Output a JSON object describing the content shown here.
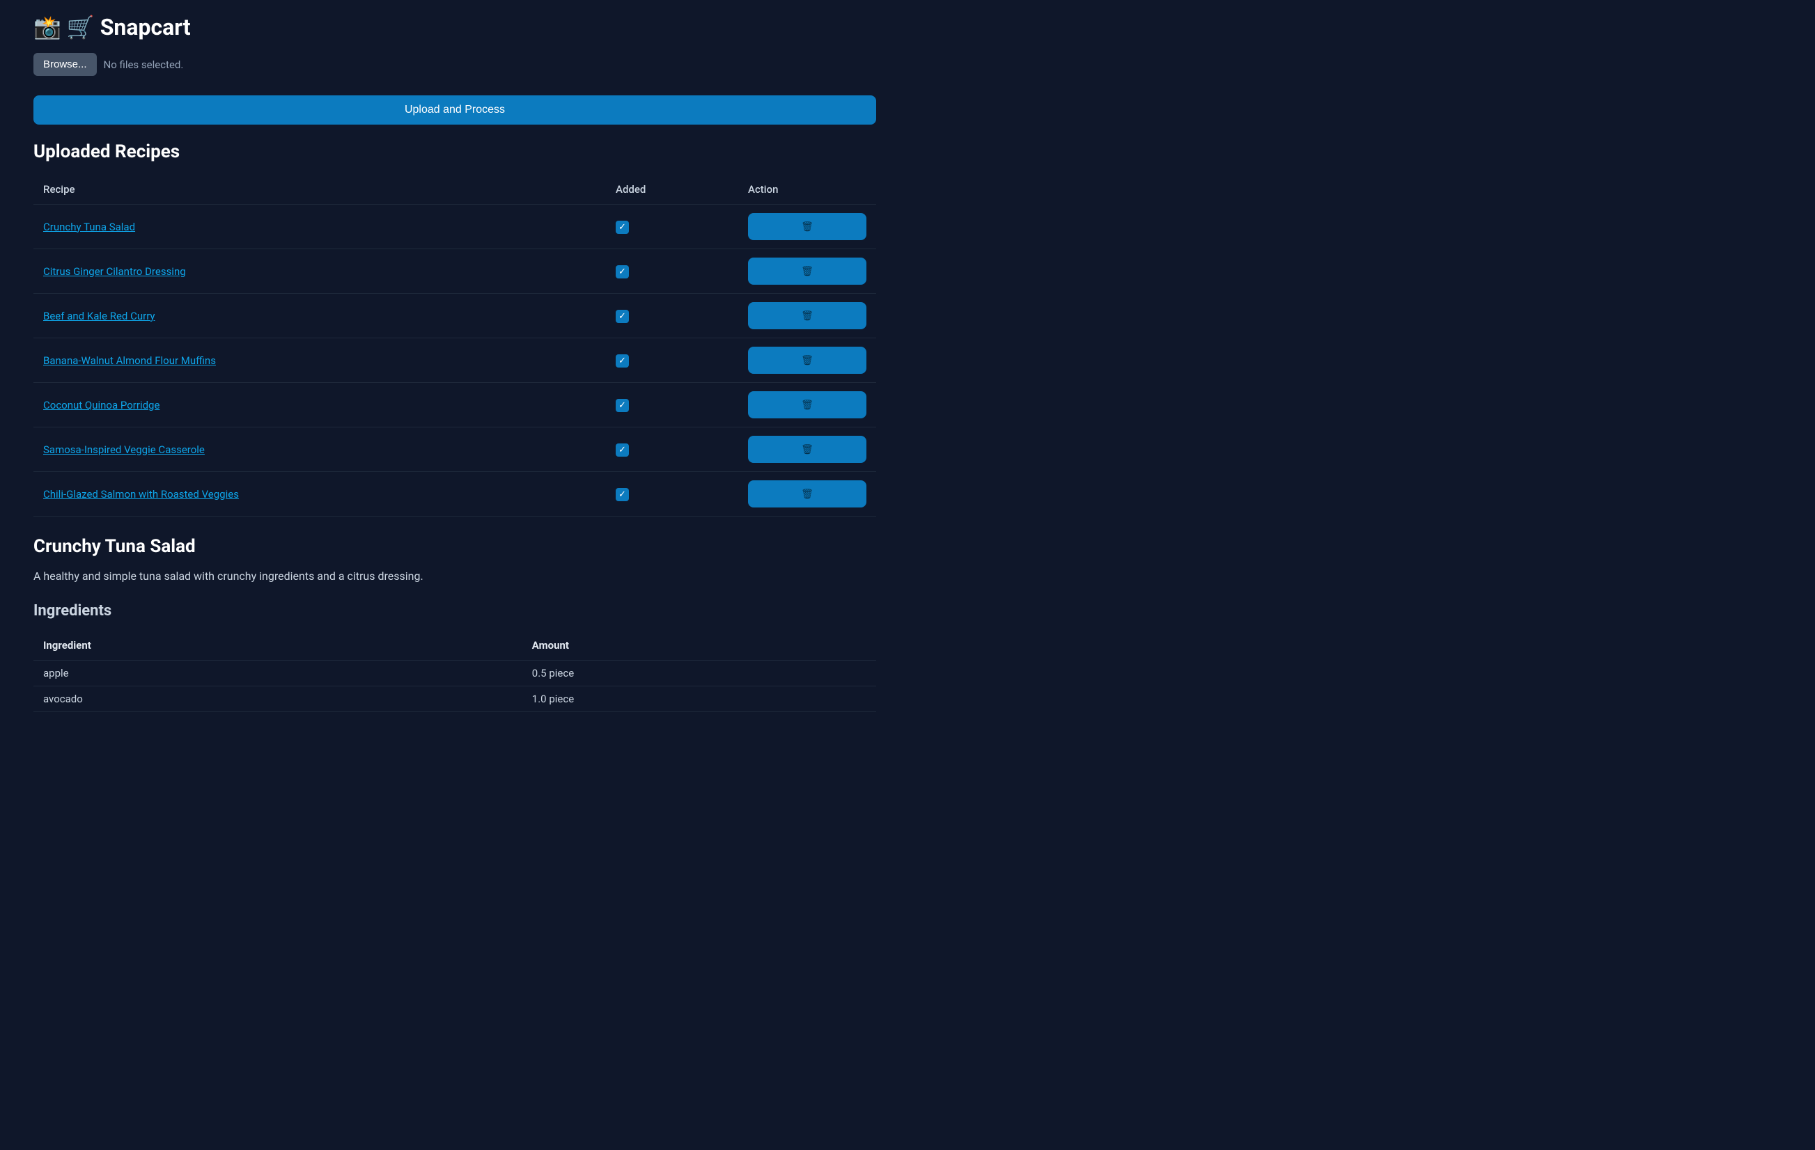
{
  "header": {
    "emoji_camera": "📸",
    "emoji_cart": "🛒",
    "title": "Snapcart"
  },
  "file_upload": {
    "browse_label": "Browse...",
    "status_text": "No files selected."
  },
  "buttons": {
    "upload_process": "Upload and Process"
  },
  "recipes_section": {
    "title": "Uploaded Recipes",
    "columns": {
      "recipe": "Recipe",
      "added": "Added",
      "action": "Action"
    },
    "rows": [
      {
        "name": "Crunchy Tuna Salad",
        "added": true,
        "active": true
      },
      {
        "name": "Citrus Ginger Cilantro Dressing",
        "added": true,
        "active": false
      },
      {
        "name": "Beef and Kale Red Curry",
        "added": true,
        "active": false
      },
      {
        "name": "Banana-Walnut Almond Flour Muffins",
        "added": true,
        "active": false
      },
      {
        "name": "Coconut Quinoa Porridge",
        "added": true,
        "active": false
      },
      {
        "name": "Samosa-Inspired Veggie Casserole",
        "added": true,
        "active": false
      },
      {
        "name": "Chili-Glazed Salmon with Roasted Veggies",
        "added": true,
        "active": false
      }
    ]
  },
  "recipe_detail": {
    "title": "Crunchy Tuna Salad",
    "description": "A healthy and simple tuna salad with crunchy ingredients and a citrus dressing."
  },
  "ingredients_section": {
    "title": "Ingredients",
    "columns": {
      "ingredient": "Ingredient",
      "amount": "Amount"
    },
    "rows": [
      {
        "ingredient": "apple",
        "amount": "0.5 piece"
      },
      {
        "ingredient": "avocado",
        "amount": "1.0 piece"
      }
    ]
  },
  "icons": {
    "check": "✓",
    "trash": "🗑"
  }
}
